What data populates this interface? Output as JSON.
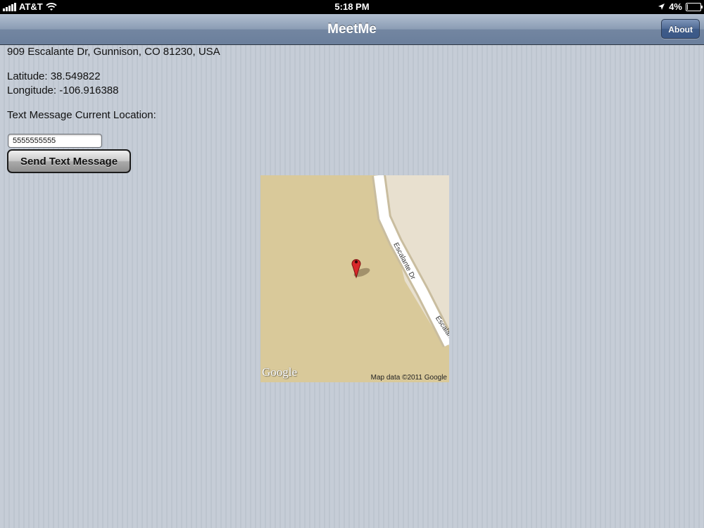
{
  "status_bar": {
    "carrier": "AT&T",
    "time": "5:18 PM",
    "battery_text": "4%",
    "battery_level_percent": 4
  },
  "nav": {
    "title": "MeetMe",
    "about_label": "About"
  },
  "location": {
    "address": "909 Escalante Dr, Gunnison, CO 81230, USA",
    "latitude_text": "Latitude: 38.549822",
    "longitude_text": "Longitude: -106.916388"
  },
  "sms": {
    "prompt": "Text Message Current Location:",
    "phone_value": "5555555555",
    "send_label": "Send Text Message"
  },
  "map": {
    "logo": "Google",
    "attribution": "Map data ©2011 Google",
    "street_label_1": "Escalante Dr",
    "street_label_2": "Escalante"
  },
  "icons": {
    "signal": "signal-bars-icon",
    "wifi": "wifi-icon",
    "location": "location-arrow-icon",
    "battery": "battery-icon",
    "pin": "map-pin-icon"
  }
}
